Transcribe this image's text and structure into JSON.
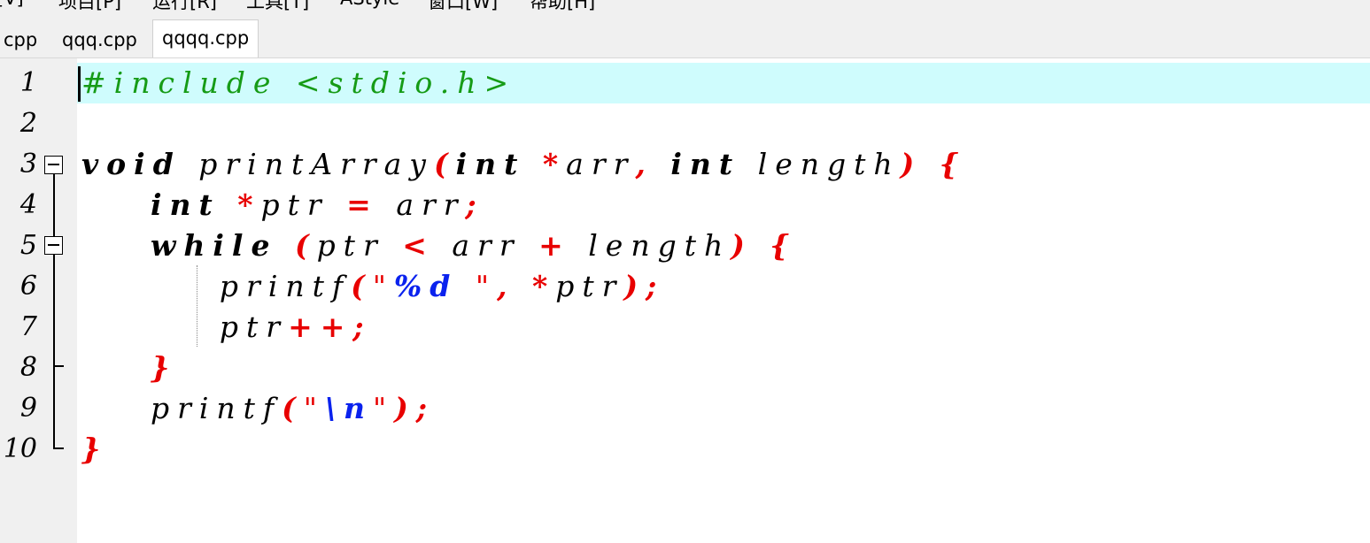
{
  "menu": {
    "items": [
      "[V]",
      "项目[P]",
      "运行[R]",
      "工具[T]",
      "AStyle",
      "窗口[W]",
      "帮助[H]"
    ]
  },
  "tabs": [
    {
      "label": "cpp",
      "active": false
    },
    {
      "label": "qqq.cpp",
      "active": false
    },
    {
      "label": "qqqq.cpp",
      "active": true
    }
  ],
  "editor": {
    "current_line": 1,
    "line_numbers": [
      "1",
      "2",
      "3",
      "4",
      "5",
      "6",
      "7",
      "8",
      "9",
      "10"
    ],
    "lines": [
      [
        {
          "t": "#include <stdio.h>",
          "c": "pp"
        }
      ],
      [],
      [
        {
          "t": "void",
          "c": "kw"
        },
        {
          "t": " printArray",
          "c": "plain"
        },
        {
          "t": "(",
          "c": "op"
        },
        {
          "t": "int",
          "c": "kw"
        },
        {
          "t": " ",
          "c": "plain"
        },
        {
          "t": "*",
          "c": "op"
        },
        {
          "t": "arr",
          "c": "plain"
        },
        {
          "t": ",",
          "c": "op"
        },
        {
          "t": " ",
          "c": "plain"
        },
        {
          "t": "int",
          "c": "kw"
        },
        {
          "t": " length",
          "c": "plain"
        },
        {
          "t": ")",
          "c": "op"
        },
        {
          "t": " ",
          "c": "plain"
        },
        {
          "t": "{",
          "c": "op"
        }
      ],
      [
        {
          "t": "    ",
          "c": "plain"
        },
        {
          "t": "int",
          "c": "kw"
        },
        {
          "t": " ",
          "c": "plain"
        },
        {
          "t": "*",
          "c": "op"
        },
        {
          "t": "ptr ",
          "c": "plain"
        },
        {
          "t": "=",
          "c": "op"
        },
        {
          "t": " arr",
          "c": "plain"
        },
        {
          "t": ";",
          "c": "op"
        }
      ],
      [
        {
          "t": "    ",
          "c": "plain"
        },
        {
          "t": "while",
          "c": "kw"
        },
        {
          "t": " ",
          "c": "plain"
        },
        {
          "t": "(",
          "c": "op"
        },
        {
          "t": "ptr ",
          "c": "plain"
        },
        {
          "t": "<",
          "c": "op"
        },
        {
          "t": " arr ",
          "c": "plain"
        },
        {
          "t": "+",
          "c": "op"
        },
        {
          "t": " length",
          "c": "plain"
        },
        {
          "t": ")",
          "c": "op"
        },
        {
          "t": " ",
          "c": "plain"
        },
        {
          "t": "{",
          "c": "op"
        }
      ],
      [
        {
          "t": "        printf",
          "c": "plain"
        },
        {
          "t": "(",
          "c": "op"
        },
        {
          "t": "\"",
          "c": "str"
        },
        {
          "t": "%d",
          "c": "fmt"
        },
        {
          "t": " \"",
          "c": "str"
        },
        {
          "t": ",",
          "c": "op"
        },
        {
          "t": " ",
          "c": "plain"
        },
        {
          "t": "*",
          "c": "op"
        },
        {
          "t": "ptr",
          "c": "plain"
        },
        {
          "t": ");",
          "c": "op"
        }
      ],
      [
        {
          "t": "        ptr",
          "c": "plain"
        },
        {
          "t": "++;",
          "c": "op"
        }
      ],
      [
        {
          "t": "    ",
          "c": "plain"
        },
        {
          "t": "}",
          "c": "op"
        }
      ],
      [
        {
          "t": "    printf",
          "c": "plain"
        },
        {
          "t": "(",
          "c": "op"
        },
        {
          "t": "\"",
          "c": "str"
        },
        {
          "t": "\\n",
          "c": "fmt"
        },
        {
          "t": "\"",
          "c": "str"
        },
        {
          "t": ");",
          "c": "op"
        }
      ],
      [
        {
          "t": "}",
          "c": "op"
        }
      ]
    ]
  },
  "colors": {
    "current_line_bg": "#cffcfd",
    "preprocessor": "#169b16",
    "operator": "#e80000",
    "format_spec": "#0a22ee",
    "keyword": "#000000"
  }
}
